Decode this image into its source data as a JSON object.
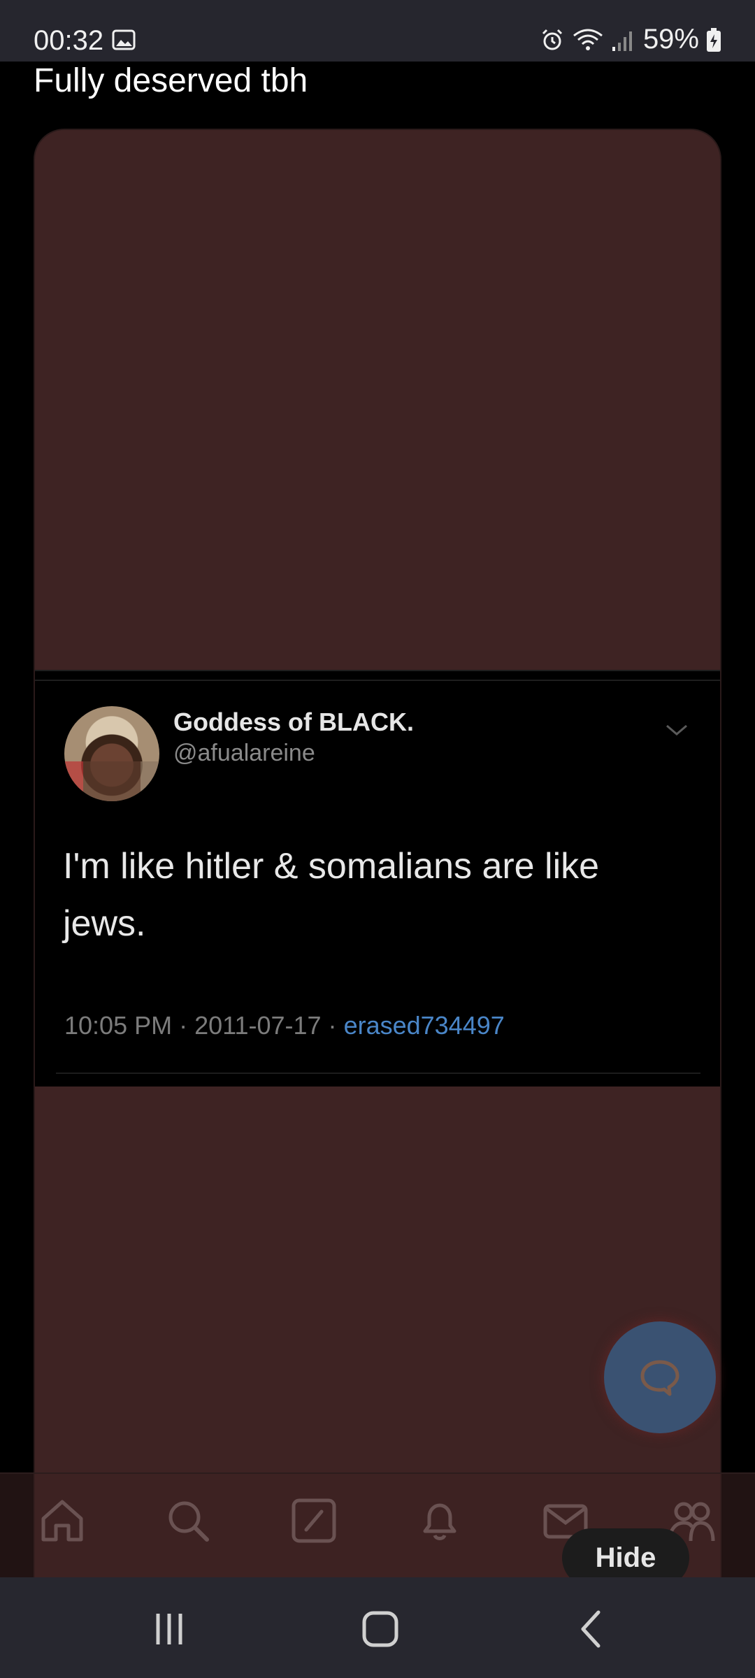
{
  "status_bar": {
    "time": "00:32",
    "battery": "59%",
    "icons": [
      "gallery-icon",
      "alarm-icon",
      "wifi-icon",
      "signal-icon",
      "battery-icon"
    ]
  },
  "post": {
    "title": "Fully deserved tbh"
  },
  "tweet": {
    "display_name": "Goddess of BLACK.",
    "handle": "@afualareine",
    "text": "I'm like hitler & somalians are like jews.",
    "timestamp": "10:05 PM · 2011-07-17 · ",
    "via": "erased734497"
  },
  "bottom_nav": {
    "items": [
      "home-icon",
      "search-icon",
      "compose-icon",
      "notifications-icon",
      "messages-icon",
      "communities-icon"
    ],
    "hide_label": "Hide"
  },
  "colors": {
    "card_bg": "#3e2323",
    "fab_bg": "#3a5272",
    "link": "#4a86c8",
    "system_bar": "#27272f"
  }
}
